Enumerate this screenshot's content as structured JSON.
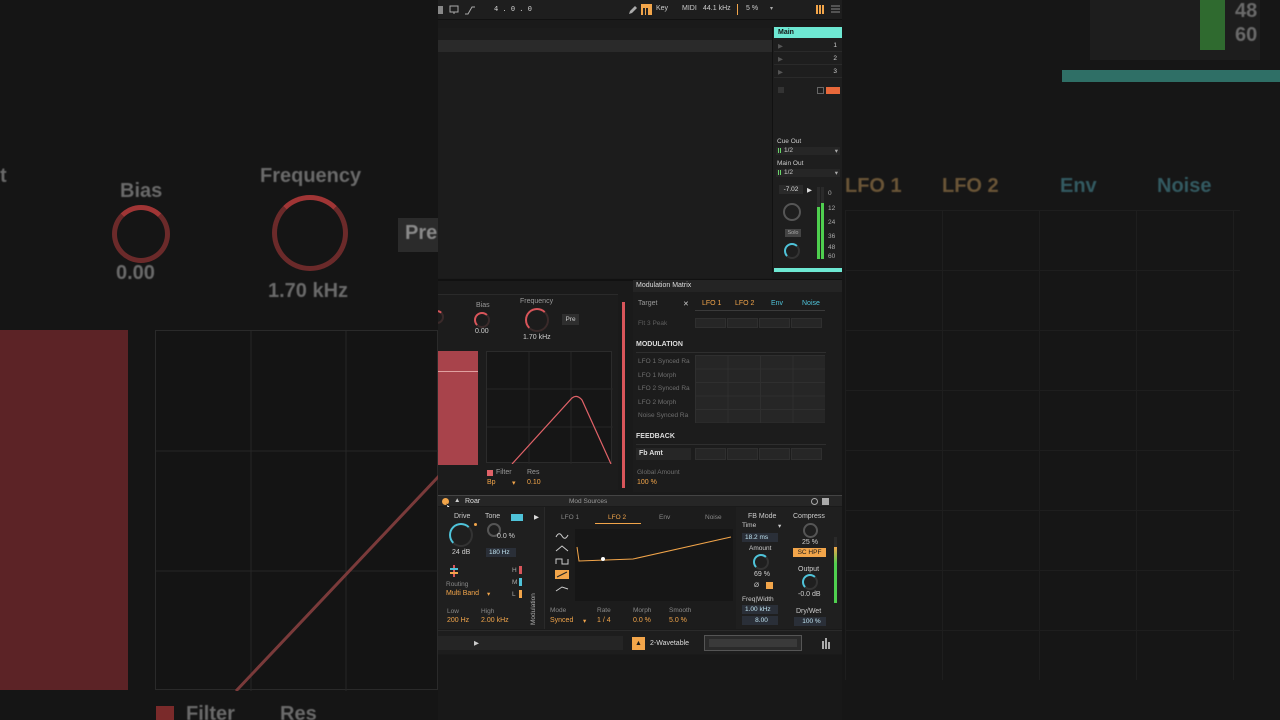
{
  "background": {
    "left": {
      "bias_label": "Bias",
      "bias_value": "0.00",
      "freq_label": "Frequency",
      "freq_value": "1.70 kHz",
      "pre_label": "Pre",
      "filter_label": "Filter",
      "res_label": "Res",
      "t_label": "t"
    },
    "right": {
      "tabs": [
        "LFO 1",
        "LFO 2",
        "Env",
        "Noise"
      ],
      "meter_top": "48",
      "meter_bot": "60"
    }
  },
  "transport": {
    "position": "4 .  0 .  0",
    "key_label": "Key",
    "midi_label": "MIDI",
    "sample_rate": "44.1 kHz",
    "cpu": "5 %"
  },
  "mixer": {
    "track_name": "Main",
    "rows": [
      "1",
      "2",
      "3"
    ],
    "cue_out_label": "Cue Out",
    "cue_out_value": "1/2",
    "main_out_label": "Main Out",
    "main_out_value": "1/2",
    "volume": "-7.02",
    "solo_label": "Solo",
    "meter_scale": [
      "0",
      "12",
      "24",
      "36",
      "48",
      "60"
    ]
  },
  "filter_panel": {
    "bias_label": "Bias",
    "bias_value": "0.00",
    "freq_label": "Frequency",
    "freq_value": "1.70 kHz",
    "pre_label": "Pre",
    "filter_label": "Filter",
    "filter_type": "Bp",
    "res_label": "Res",
    "res_value": "0.10"
  },
  "mod_matrix": {
    "title": "Modulation Matrix",
    "target_label": "Target",
    "columns": [
      "LFO 1",
      "LFO 2",
      "Env",
      "Noise"
    ],
    "top_row": "Flt 3 Peak",
    "modulation_header": "MODULATION",
    "modulation_rows": [
      "LFO 1 Synced Ra",
      "LFO 1 Morph",
      "LFO 2 Synced Ra",
      "LFO 2 Morph",
      "Noise Synced Ra"
    ],
    "feedback_header": "FEEDBACK",
    "feedback_row": "Fb Amt",
    "global_label": "Global Amount",
    "global_value": "100 %"
  },
  "device": {
    "name": "Roar",
    "drive_label": "Drive",
    "drive_value": "24 dB",
    "tone_label": "Tone",
    "tone_value": "0.0 %",
    "tone_freq": "180 Hz",
    "routing_label": "Routing",
    "routing_value": "Multi Band",
    "hml": [
      "H",
      "M",
      "L"
    ],
    "low_label": "Low",
    "low_value": "200 Hz",
    "high_label": "High",
    "high_value": "2.00 kHz",
    "modulation_side": "Modulation",
    "mod_sources_title": "Mod Sources",
    "mod_tabs": [
      "LFO 1",
      "LFO 2",
      "Env",
      "Noise"
    ],
    "mode_label": "Mode",
    "mode_value": "Synced",
    "rate_label": "Rate",
    "rate_value": "1 / 4",
    "morph_label": "Morph",
    "morph_value": "0.0 %",
    "smooth_label": "Smooth",
    "smooth_value": "5.0 %",
    "fb_mode_label": "FB Mode",
    "fb_time_label": "Time",
    "fb_time_value": "18.2 ms",
    "amount_label": "Amount",
    "amount_value": "69 %",
    "phase_label": "Ø",
    "freq_width_label": "Freq|Width",
    "freq_width_value": "1.00 kHz",
    "width_value": "8.00",
    "compress_label": "Compress",
    "compress_value": "25 %",
    "sc_hpf_label": "SC HPF",
    "output_label": "Output",
    "output_value": "-0.0 dB",
    "dry_wet_label": "Dry/Wet",
    "dry_wet_value": "100 %"
  },
  "footer": {
    "instrument": "2-Wavetable"
  },
  "colors": {
    "accent_orange": "#f2a54a",
    "accent_cyan": "#4fc3d9",
    "filter_red": "#d8555a",
    "track_header": "#6ee8d3"
  }
}
